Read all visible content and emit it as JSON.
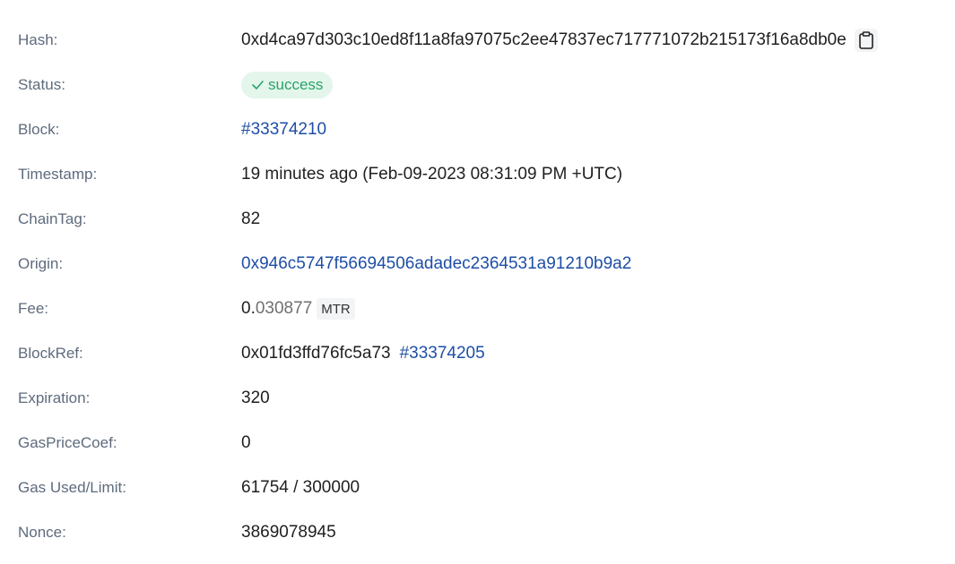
{
  "transaction": {
    "hash": {
      "label": "Hash:",
      "value": "0xd4ca97d303c10ed8f11a8fa97075c2ee47837ec717771072b215173f16a8db0e",
      "copy_icon": "clipboard-icon"
    },
    "status": {
      "label": "Status:",
      "value": "success",
      "icon": "check-icon",
      "color": "#29a36a",
      "background": "#e4f6ec"
    },
    "block": {
      "label": "Block:",
      "value": "#33374210"
    },
    "timestamp": {
      "label": "Timestamp:",
      "value": "19 minutes ago (Feb-09-2023 08:31:09 PM +UTC)"
    },
    "chaintag": {
      "label": "ChainTag:",
      "value": "82"
    },
    "origin": {
      "label": "Origin:",
      "value": "0x946c5747f56694506adadec2364531a91210b9a2"
    },
    "fee": {
      "label": "Fee:",
      "integer": "0.",
      "decimals": "030877",
      "unit": "MTR"
    },
    "blockref": {
      "label": "BlockRef:",
      "value": "0x01fd3ffd76fc5a73",
      "block_link": "#33374205"
    },
    "expiration": {
      "label": "Expiration:",
      "value": "320"
    },
    "gaspricecoef": {
      "label": "GasPriceCoef:",
      "value": "0"
    },
    "gas": {
      "label": "Gas Used/Limit:",
      "value": "61754 / 300000"
    },
    "nonce": {
      "label": "Nonce:",
      "value": "3869078945"
    }
  },
  "colors": {
    "label": "#5e6b7d",
    "text": "#1f1f1f",
    "link": "#1e4ea6",
    "muted": "#6f6f6f"
  }
}
